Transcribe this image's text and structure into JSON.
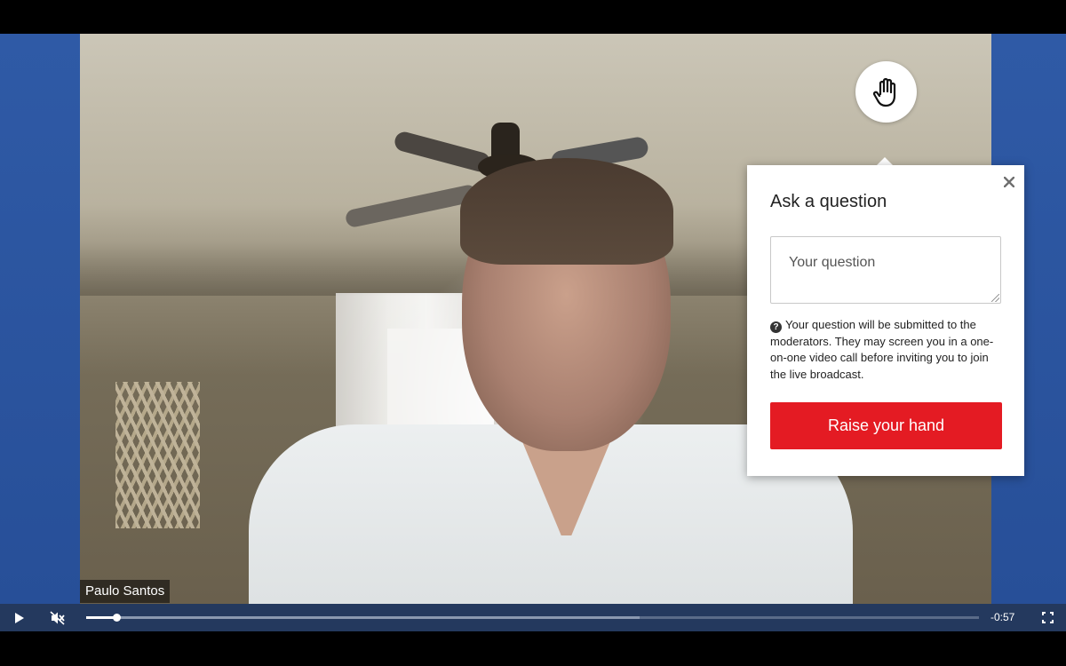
{
  "video": {
    "speaker_name": "Paulo Santos"
  },
  "raise_hand": {
    "icon": "hand-icon"
  },
  "popover": {
    "title": "Ask a question",
    "close_icon": "close-icon",
    "input_placeholder": "Your question",
    "input_value": "",
    "help_icon": "question-circle-icon",
    "help_text": "Your question will be submitted to the moderators. They may screen you in a one-on-one video call before inviting you to join the live broadcast.",
    "submit_label": "Raise your hand",
    "submit_color": "#e41b23"
  },
  "player": {
    "play_icon": "play-icon",
    "mute_icon": "muted-speaker-icon",
    "progress_fraction": 0.034,
    "buffered_fraction": 0.62,
    "time_remaining": "-0:57",
    "fullscreen_icon": "fullscreen-icon",
    "accent": "#24395e"
  }
}
